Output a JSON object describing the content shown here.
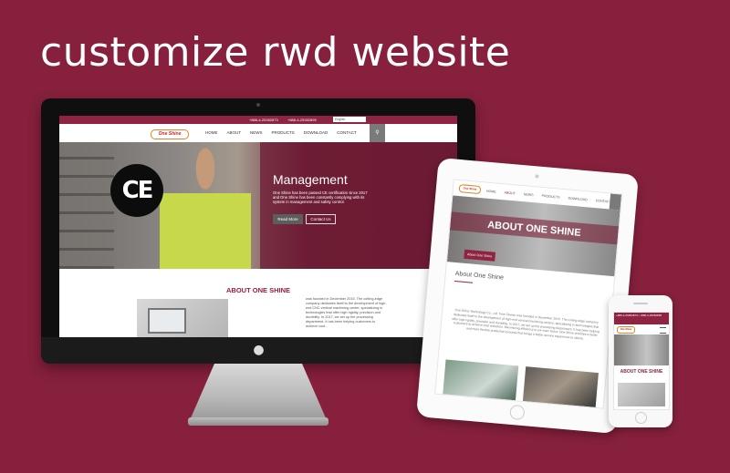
{
  "headline": "customize rwd website",
  "desktop": {
    "topbar": {
      "phone1": "+886-4-25352873",
      "phone2": "+886-4-25352895",
      "language": "English"
    },
    "logo": "One Shine",
    "nav": [
      "HOME",
      "ABOUT",
      "NEWS",
      "PRODUCTS",
      "DOWNLOAD",
      "CONTACT"
    ],
    "hero": {
      "badge": "CE",
      "title": "Management",
      "description": "One Shine has been passed CE certification since 2017 and One Shine has been constantly complying with its system in management and safety control.",
      "read_more": "Read More",
      "contact_us": "Contact Us"
    },
    "about": {
      "title": "ABOUT ONE SHINE",
      "text": "was founded in December 2015. The cutting-edge company dedicates itself to the development of high-end CNC vertical machining center, specializing in technologies that offer high rigidity, precision and durability. In 2017, we set up the processing department. It has been helping customers to achieve cost..."
    }
  },
  "tablet": {
    "logo": "One Shine",
    "nav": [
      "HOME",
      "ABOUT",
      "NEWS",
      "PRODUCTS",
      "DOWNLOAD",
      "CONTACT"
    ],
    "banner_title": "ABOUT ONE SHINE",
    "banner_tag": "About One Shine",
    "heading": "About One Shine",
    "paragraph": "One Shine Technology Co., Ltd. from Taiwan was founded in December 2015. The cutting-edge company dedicates itself to the development of high-end vertical machining centers, specializing in technologies that offer high rigidity, precision and durability. In 2017, we set up the processing department. It has been helping customers to achieve cost reduction. Maximizing efficiency is our main focus. One Shine provides a faster and more flexible production process that brings a better service experience to clients."
  },
  "phone": {
    "topbar": "+886-4-25352873 / +886-4-25352895",
    "logo": "One Shine",
    "about_title": "ABOUT ONE SHINE"
  },
  "colors": {
    "background": "#86203c",
    "brand": "#8e2342",
    "accent": "#e1861f"
  }
}
